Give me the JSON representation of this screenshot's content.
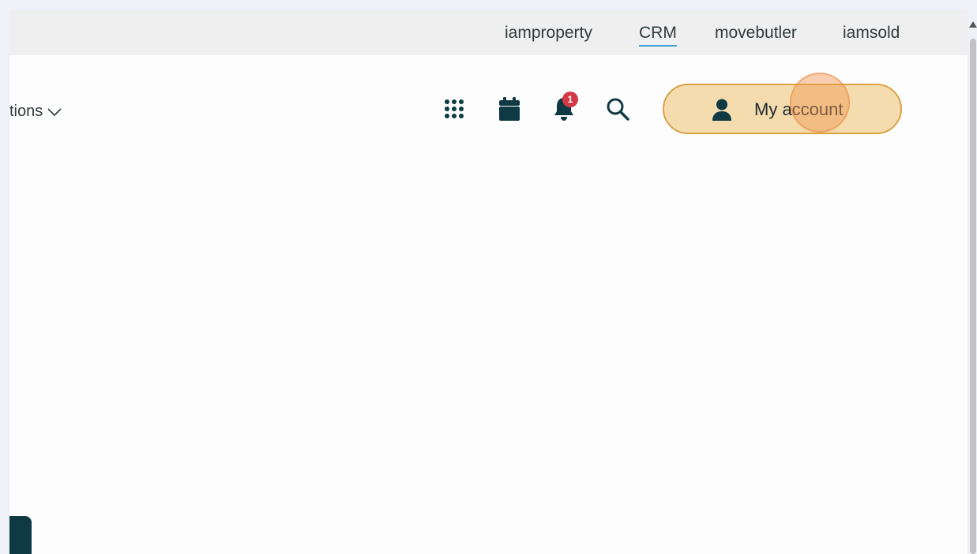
{
  "topbar": {
    "links": [
      {
        "label": "iamproperty"
      },
      {
        "label": "CRM"
      },
      {
        "label": "movebutler"
      },
      {
        "label": "iamsold"
      }
    ],
    "active_link": "CRM"
  },
  "nav": {
    "partial_label": "tions"
  },
  "toolbar": {
    "apps_icon": "grid-icon",
    "calendar_icon": "calendar-icon",
    "notifications_icon": "bell-icon",
    "notification_count": "1",
    "search_icon": "search-icon",
    "account_label": "My account",
    "account_icon": "user-icon"
  },
  "colors": {
    "accent_underline": "#3fa5d6",
    "account_bg": "#f4dcae",
    "account_border": "#d8a347",
    "badge": "#d33a45",
    "icon_dark": "#0f3a43"
  }
}
